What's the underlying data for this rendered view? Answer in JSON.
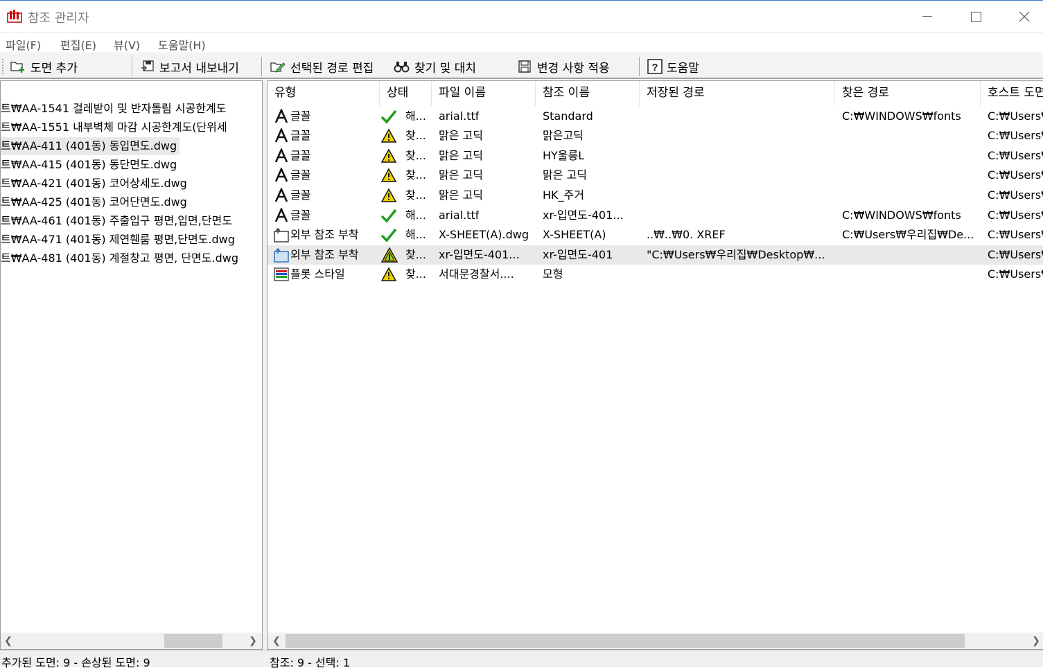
{
  "window": {
    "title": "참조 관리자"
  },
  "menu": [
    "파일(F)",
    "편집(E)",
    "뷰(V)",
    "도움말(H)"
  ],
  "toolbar": {
    "add_drawing": "도면 추가",
    "export_report": "보고서 내보내기",
    "edit_selected_path": "선택된 경로 편집",
    "find_replace": "찾기 및 대치",
    "apply_changes": "변경 사항 적용",
    "help": "도움말"
  },
  "drawings": [
    "트₩AA-1541 걸레받이 및 반자돌림 시공한계도",
    "트₩AA-1551 내부벽체 마감 시공한계도(단위세",
    "트₩AA-411 (401동) 동입면도.dwg",
    "트₩AA-415 (401동) 동단면도.dwg",
    "트₩AA-421 (401동) 코어상세도.dwg",
    "트₩AA-425 (401동) 코어단면도.dwg",
    "트₩AA-461 (401동) 주출입구 평면,입면,단면도",
    "트₩AA-471 (401동) 제연휀룸 평면,단면도.dwg",
    "트₩AA-481 (401동) 계절창고 평면, 단면도.dwg"
  ],
  "columns": [
    "유형",
    "상태",
    "파일 이름",
    "참조 이름",
    "저장된 경로",
    "찾은 경로",
    "호스트 도면"
  ],
  "references": [
    {
      "type": "글꼴",
      "type_icon": "font-icon",
      "status_icon": "check-icon",
      "status": "해...",
      "file": "arial.ttf",
      "ref": "Standard",
      "saved": "",
      "found": "C:₩WINDOWS₩fonts",
      "host": "C:₩Users₩"
    },
    {
      "type": "글꼴",
      "type_icon": "font-icon",
      "status_icon": "warning-icon",
      "status": "찾...",
      "file": "맑은 고딕",
      "ref": "맑은고딕",
      "saved": "",
      "found": "",
      "host": "C:₩Users₩"
    },
    {
      "type": "글꼴",
      "type_icon": "font-icon",
      "status_icon": "warning-icon",
      "status": "찾...",
      "file": "맑은 고딕",
      "ref": "HY울릉L",
      "saved": "",
      "found": "",
      "host": "C:₩Users₩"
    },
    {
      "type": "글꼴",
      "type_icon": "font-icon",
      "status_icon": "warning-icon",
      "status": "찾...",
      "file": "맑은 고딕",
      "ref": "맑은 고딕",
      "saved": "",
      "found": "",
      "host": "C:₩Users₩"
    },
    {
      "type": "글꼴",
      "type_icon": "font-icon",
      "status_icon": "warning-icon",
      "status": "찾...",
      "file": "맑은 고딕",
      "ref": "HK_주거",
      "saved": "",
      "found": "",
      "host": "C:₩Users₩"
    },
    {
      "type": "글꼴",
      "type_icon": "font-icon",
      "status_icon": "check-icon",
      "status": "해...",
      "file": "arial.ttf",
      "ref": "xr-입면도-401...",
      "saved": "",
      "found": "C:₩WINDOWS₩fonts",
      "host": "C:₩Users₩"
    },
    {
      "type": "외부 참조 부착",
      "type_icon": "xref-icon",
      "status_icon": "check-icon",
      "status": "해...",
      "file": "X-SHEET(A).dwg",
      "ref": "X-SHEET(A)",
      "saved": "..₩..₩0. XREF",
      "found": "C:₩Users₩우리집₩De...",
      "host": "C:₩Users₩"
    },
    {
      "type": "외부 참조 부착",
      "type_icon": "xref-selected-icon",
      "status_icon": "warning-double-icon",
      "status": "찾...",
      "file": "xr-입면도-401...",
      "ref": "xr-입면도-401",
      "saved": "\"C:₩Users₩우리집₩Desktop₩...",
      "found": "",
      "host": "C:₩Users₩"
    },
    {
      "type": "플롯 스타일",
      "type_icon": "plot-style-icon",
      "status_icon": "warning-icon",
      "status": "찾...",
      "file": "서대문경찰서....",
      "ref": "모형",
      "saved": "",
      "found": "",
      "host": "C:₩Users₩"
    }
  ],
  "status": {
    "left": "추가된 도면: 9  -  손상된 도면: 9",
    "right": "참조: 9  -  선택: 1"
  },
  "colors": {
    "check": "#1e9e1e",
    "warning": "#f0d000",
    "accent": "#3a7bbf"
  }
}
